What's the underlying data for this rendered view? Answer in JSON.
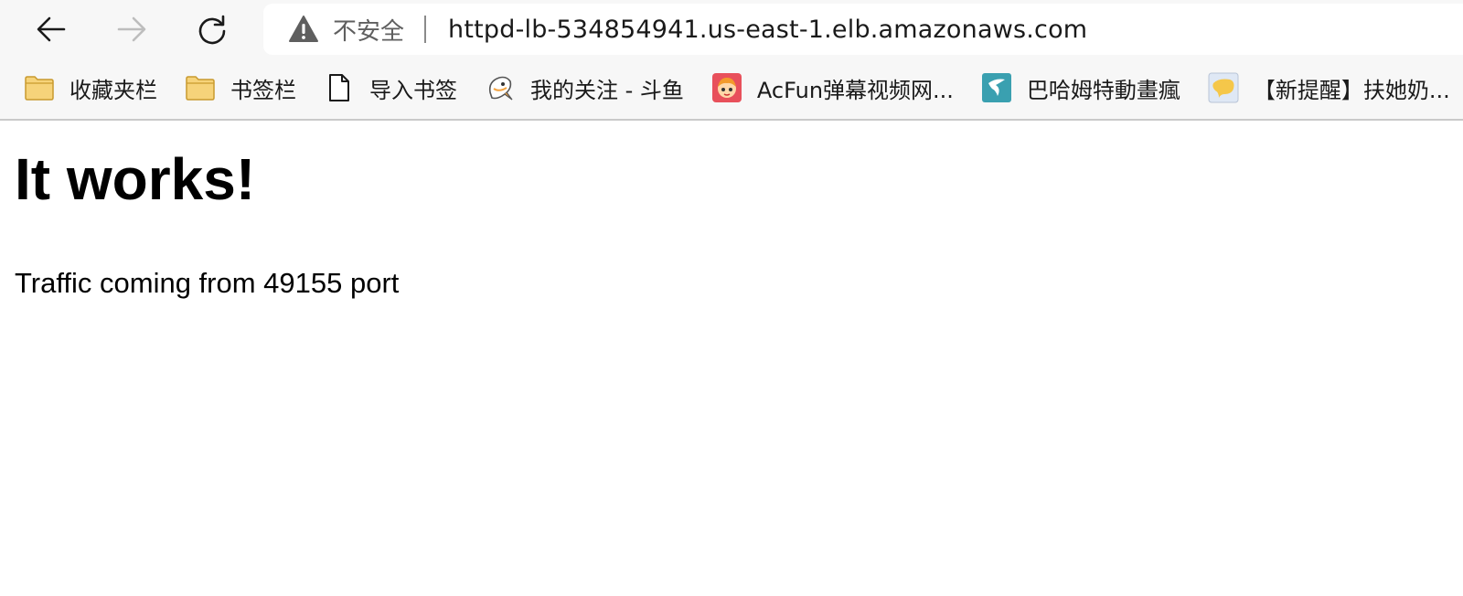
{
  "toolbar": {
    "back_icon": "arrow-left-icon",
    "forward_icon": "arrow-right-icon",
    "reload_icon": "reload-icon",
    "security_icon": "warning-triangle-icon",
    "security_label": "不安全",
    "url": "httpd-lb-534854941.us-east-1.elb.amazonaws.com"
  },
  "bookmarks": [
    {
      "label": "收藏夹栏",
      "icon": "folder-icon"
    },
    {
      "label": "书签栏",
      "icon": "folder-icon"
    },
    {
      "label": "导入书签",
      "icon": "document-icon"
    },
    {
      "label": "我的关注 - 斗鱼",
      "icon": "douyu-shark-icon"
    },
    {
      "label": "AcFun弹幕视频网...",
      "icon": "acfun-icon"
    },
    {
      "label": "巴哈姆特動畫瘋",
      "icon": "bahamut-icon"
    },
    {
      "label": "【新提醒】扶她奶...",
      "icon": "site-favicon-icon"
    }
  ],
  "page": {
    "heading": "It works!",
    "body": "Traffic coming from 49155 port"
  },
  "colors": {
    "chrome_bg": "#f7f7f7",
    "address_bg": "#ffffff",
    "folder_yellow": "#f6d37a",
    "acfun_red": "#e8505b",
    "bahamut_teal": "#3aa0b0"
  }
}
